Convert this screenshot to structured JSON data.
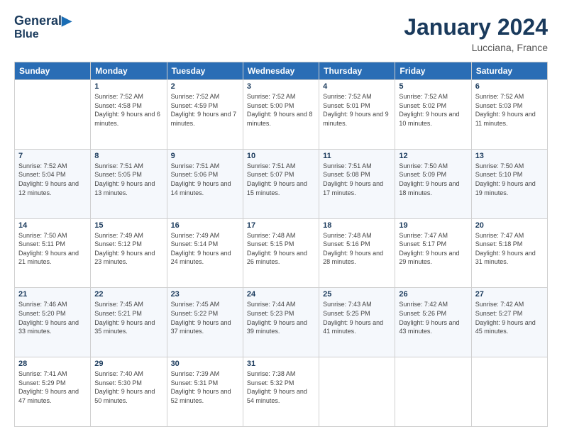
{
  "header": {
    "logo_line1": "General",
    "logo_line2": "Blue",
    "month": "January 2024",
    "location": "Lucciana, France"
  },
  "weekdays": [
    "Sunday",
    "Monday",
    "Tuesday",
    "Wednesday",
    "Thursday",
    "Friday",
    "Saturday"
  ],
  "weeks": [
    [
      {
        "day": "",
        "sunrise": "",
        "sunset": "",
        "daylight": ""
      },
      {
        "day": "1",
        "sunrise": "Sunrise: 7:52 AM",
        "sunset": "Sunset: 4:58 PM",
        "daylight": "Daylight: 9 hours and 6 minutes."
      },
      {
        "day": "2",
        "sunrise": "Sunrise: 7:52 AM",
        "sunset": "Sunset: 4:59 PM",
        "daylight": "Daylight: 9 hours and 7 minutes."
      },
      {
        "day": "3",
        "sunrise": "Sunrise: 7:52 AM",
        "sunset": "Sunset: 5:00 PM",
        "daylight": "Daylight: 9 hours and 8 minutes."
      },
      {
        "day": "4",
        "sunrise": "Sunrise: 7:52 AM",
        "sunset": "Sunset: 5:01 PM",
        "daylight": "Daylight: 9 hours and 9 minutes."
      },
      {
        "day": "5",
        "sunrise": "Sunrise: 7:52 AM",
        "sunset": "Sunset: 5:02 PM",
        "daylight": "Daylight: 9 hours and 10 minutes."
      },
      {
        "day": "6",
        "sunrise": "Sunrise: 7:52 AM",
        "sunset": "Sunset: 5:03 PM",
        "daylight": "Daylight: 9 hours and 11 minutes."
      }
    ],
    [
      {
        "day": "7",
        "sunrise": "Sunrise: 7:52 AM",
        "sunset": "Sunset: 5:04 PM",
        "daylight": "Daylight: 9 hours and 12 minutes."
      },
      {
        "day": "8",
        "sunrise": "Sunrise: 7:51 AM",
        "sunset": "Sunset: 5:05 PM",
        "daylight": "Daylight: 9 hours and 13 minutes."
      },
      {
        "day": "9",
        "sunrise": "Sunrise: 7:51 AM",
        "sunset": "Sunset: 5:06 PM",
        "daylight": "Daylight: 9 hours and 14 minutes."
      },
      {
        "day": "10",
        "sunrise": "Sunrise: 7:51 AM",
        "sunset": "Sunset: 5:07 PM",
        "daylight": "Daylight: 9 hours and 15 minutes."
      },
      {
        "day": "11",
        "sunrise": "Sunrise: 7:51 AM",
        "sunset": "Sunset: 5:08 PM",
        "daylight": "Daylight: 9 hours and 17 minutes."
      },
      {
        "day": "12",
        "sunrise": "Sunrise: 7:50 AM",
        "sunset": "Sunset: 5:09 PM",
        "daylight": "Daylight: 9 hours and 18 minutes."
      },
      {
        "day": "13",
        "sunrise": "Sunrise: 7:50 AM",
        "sunset": "Sunset: 5:10 PM",
        "daylight": "Daylight: 9 hours and 19 minutes."
      }
    ],
    [
      {
        "day": "14",
        "sunrise": "Sunrise: 7:50 AM",
        "sunset": "Sunset: 5:11 PM",
        "daylight": "Daylight: 9 hours and 21 minutes."
      },
      {
        "day": "15",
        "sunrise": "Sunrise: 7:49 AM",
        "sunset": "Sunset: 5:12 PM",
        "daylight": "Daylight: 9 hours and 23 minutes."
      },
      {
        "day": "16",
        "sunrise": "Sunrise: 7:49 AM",
        "sunset": "Sunset: 5:14 PM",
        "daylight": "Daylight: 9 hours and 24 minutes."
      },
      {
        "day": "17",
        "sunrise": "Sunrise: 7:48 AM",
        "sunset": "Sunset: 5:15 PM",
        "daylight": "Daylight: 9 hours and 26 minutes."
      },
      {
        "day": "18",
        "sunrise": "Sunrise: 7:48 AM",
        "sunset": "Sunset: 5:16 PM",
        "daylight": "Daylight: 9 hours and 28 minutes."
      },
      {
        "day": "19",
        "sunrise": "Sunrise: 7:47 AM",
        "sunset": "Sunset: 5:17 PM",
        "daylight": "Daylight: 9 hours and 29 minutes."
      },
      {
        "day": "20",
        "sunrise": "Sunrise: 7:47 AM",
        "sunset": "Sunset: 5:18 PM",
        "daylight": "Daylight: 9 hours and 31 minutes."
      }
    ],
    [
      {
        "day": "21",
        "sunrise": "Sunrise: 7:46 AM",
        "sunset": "Sunset: 5:20 PM",
        "daylight": "Daylight: 9 hours and 33 minutes."
      },
      {
        "day": "22",
        "sunrise": "Sunrise: 7:45 AM",
        "sunset": "Sunset: 5:21 PM",
        "daylight": "Daylight: 9 hours and 35 minutes."
      },
      {
        "day": "23",
        "sunrise": "Sunrise: 7:45 AM",
        "sunset": "Sunset: 5:22 PM",
        "daylight": "Daylight: 9 hours and 37 minutes."
      },
      {
        "day": "24",
        "sunrise": "Sunrise: 7:44 AM",
        "sunset": "Sunset: 5:23 PM",
        "daylight": "Daylight: 9 hours and 39 minutes."
      },
      {
        "day": "25",
        "sunrise": "Sunrise: 7:43 AM",
        "sunset": "Sunset: 5:25 PM",
        "daylight": "Daylight: 9 hours and 41 minutes."
      },
      {
        "day": "26",
        "sunrise": "Sunrise: 7:42 AM",
        "sunset": "Sunset: 5:26 PM",
        "daylight": "Daylight: 9 hours and 43 minutes."
      },
      {
        "day": "27",
        "sunrise": "Sunrise: 7:42 AM",
        "sunset": "Sunset: 5:27 PM",
        "daylight": "Daylight: 9 hours and 45 minutes."
      }
    ],
    [
      {
        "day": "28",
        "sunrise": "Sunrise: 7:41 AM",
        "sunset": "Sunset: 5:29 PM",
        "daylight": "Daylight: 9 hours and 47 minutes."
      },
      {
        "day": "29",
        "sunrise": "Sunrise: 7:40 AM",
        "sunset": "Sunset: 5:30 PM",
        "daylight": "Daylight: 9 hours and 50 minutes."
      },
      {
        "day": "30",
        "sunrise": "Sunrise: 7:39 AM",
        "sunset": "Sunset: 5:31 PM",
        "daylight": "Daylight: 9 hours and 52 minutes."
      },
      {
        "day": "31",
        "sunrise": "Sunrise: 7:38 AM",
        "sunset": "Sunset: 5:32 PM",
        "daylight": "Daylight: 9 hours and 54 minutes."
      },
      {
        "day": "",
        "sunrise": "",
        "sunset": "",
        "daylight": ""
      },
      {
        "day": "",
        "sunrise": "",
        "sunset": "",
        "daylight": ""
      },
      {
        "day": "",
        "sunrise": "",
        "sunset": "",
        "daylight": ""
      }
    ]
  ]
}
